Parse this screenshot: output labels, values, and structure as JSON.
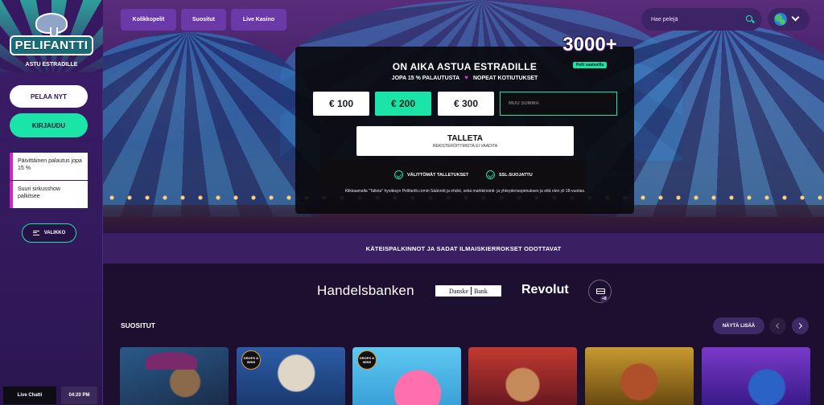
{
  "brand": {
    "name": "PELIFANTTI",
    "tagline": "ASTU ESTRADILLE"
  },
  "sidebar": {
    "play_label": "PELAA NYT",
    "login_label": "KIRJAUDU",
    "promos": [
      {
        "text": "Päivittäinen palautus jopa 15 %"
      },
      {
        "text": "Suuri sirkusshow palkitsee"
      }
    ],
    "menu_label": "VALIKKO",
    "chat_label": "Live Chatti",
    "clock": "04:20 PM"
  },
  "nav": {
    "items": [
      {
        "label": "Kolikkopelit"
      },
      {
        "label": "Suositut"
      },
      {
        "label": "Live Kasino"
      }
    ],
    "search_placeholder": "Hae pelejä",
    "language_icon": "globe-icon"
  },
  "hero": {
    "badge_number": "3000+",
    "badge_sub": "Pelit saatavilla",
    "title": "ON AIKA ASTUA ESTRADILLE",
    "subtitle_left": "JOPA 15 % PALAUTUSTA",
    "subtitle_right": "NOPEAT KOTIUTUKSET",
    "amounts": [
      "€ 100",
      "€ 200",
      "€ 300"
    ],
    "selected_amount_index": 1,
    "custom_amount_placeholder": "MUU SUMMA",
    "deposit_button": "TALLETA",
    "deposit_sub": "REKISTERÖITYMISTÄ EI VAADITA",
    "features": [
      "VÄLITTÖMÄT TALLETUKSET",
      "SSL-SUOJATTU"
    ],
    "terms": "Klikkaamalla \"Talleta\" hyväksyn Pelifantti.comin Säännöt ja ehdot, sekä markkinointi- ja yhteydensopimuksen ja että olen yli 18-vuotias."
  },
  "strip": {
    "text": "KÄTEISPALKINNOT JA SADAT ILMAISKIERROKSET ODOTTAVAT"
  },
  "payments": {
    "handelsbanken": "Handelsbanken",
    "danske_left": "Danske",
    "danske_right": "Bank",
    "revolut": "Revolut",
    "more_count": "+8"
  },
  "popular": {
    "title": "SUOSITUT",
    "show_all": "NÄYTÄ LISÄÄ",
    "drops_wins": "DROPS & WINS"
  },
  "colors": {
    "accent": "#1be5a6",
    "purple": "#6b3aa8",
    "pink": "#e23fd0"
  }
}
